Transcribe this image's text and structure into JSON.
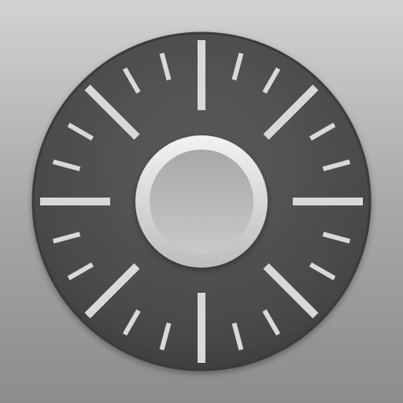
{
  "icon": {
    "name": "dial-app-icon",
    "description_symbol": "rotary-dial-icon",
    "tick_count": 24,
    "major_every": 3
  },
  "colors": {
    "background_top": "#d2d2d2",
    "background_bottom": "#8c8c8c",
    "dial_face": "#4f4f4f",
    "dial_edge": "#3a3a3a",
    "tick": "#d9d9d9",
    "knob_ring": "#e6e6e6",
    "knob_center": "#b8b8b8"
  }
}
